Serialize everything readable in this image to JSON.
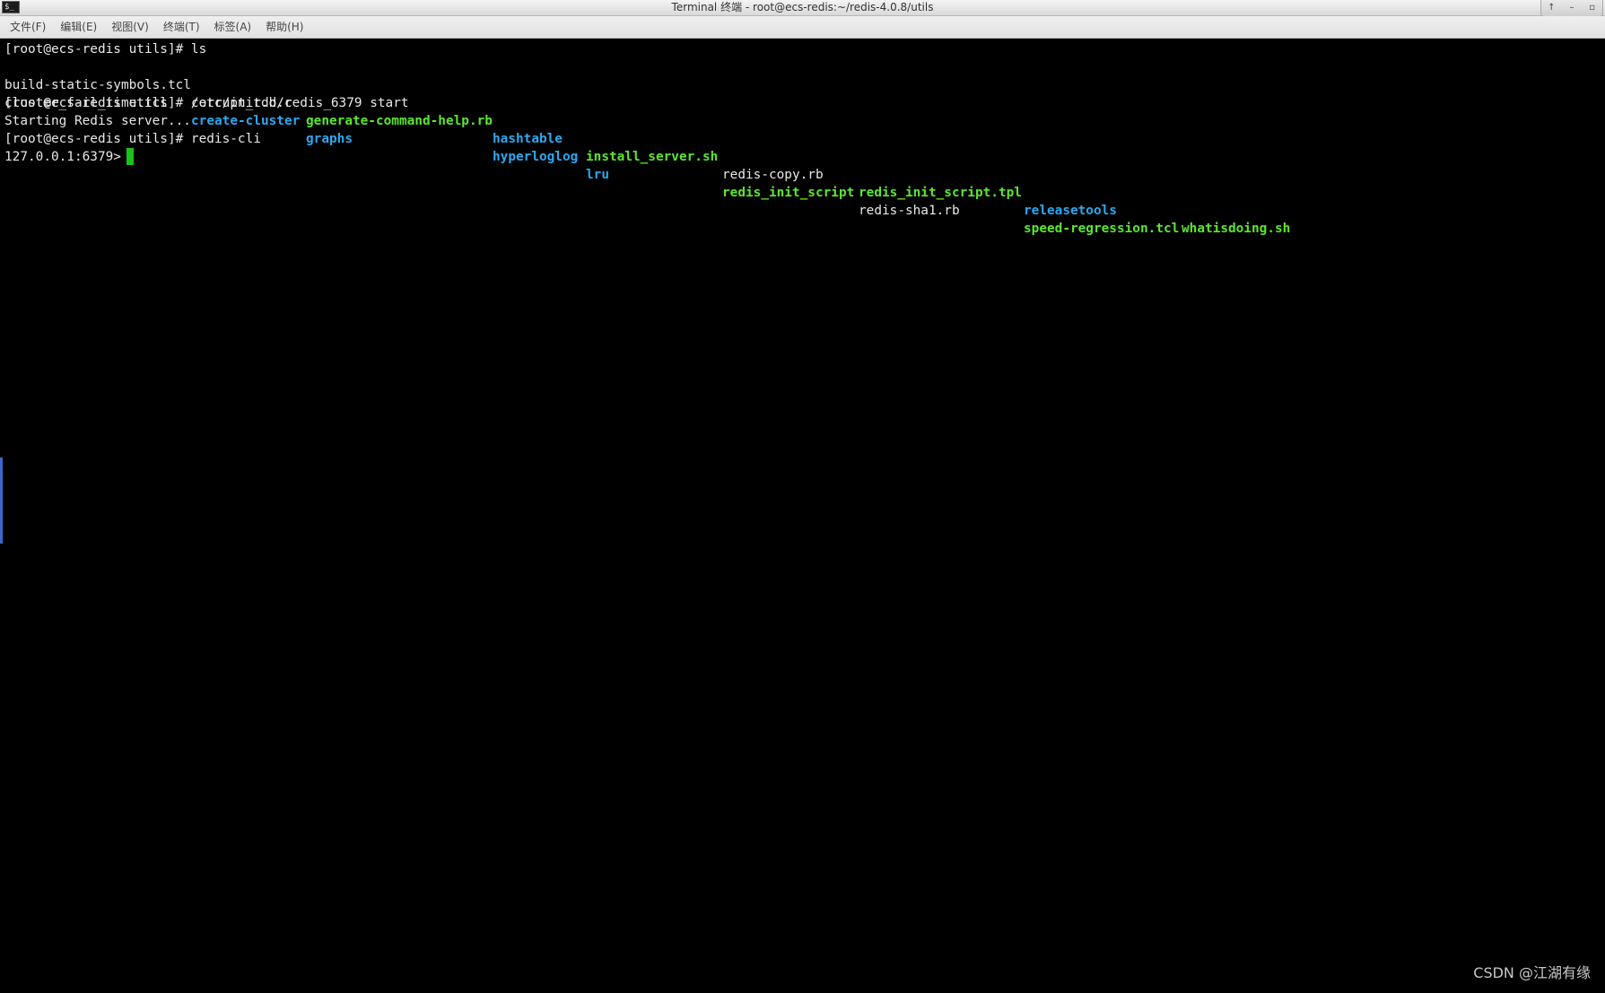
{
  "window": {
    "title": "Terminal 终端 - root@ecs-redis:~/redis-4.0.8/utils",
    "app_icon_glyph": "$_",
    "controls": [
      "↑",
      "–",
      "▫"
    ]
  },
  "menu": [
    "文件(F)",
    "编辑(E)",
    "视图(V)",
    "终端(T)",
    "标签(A)",
    "帮助(H)"
  ],
  "terminal": {
    "colors": {
      "executable": "#5ce62f",
      "directory": "#2da8f0",
      "text": "#e8e8e8",
      "cursor": "#19c319",
      "background": "#000000"
    },
    "line1": "[root@ecs-redis utils]# ls",
    "ls_row1": [
      {
        "name": "build-static-symbols.tcl",
        "type": "plain"
      },
      {
        "name": "corrupt_rdb.c",
        "type": "plain"
      },
      {
        "name": "generate-command-help.rb",
        "type": "exec"
      },
      {
        "name": "hashtable",
        "type": "dir"
      },
      {
        "name": "install_server.sh",
        "type": "exec"
      },
      {
        "name": "redis-copy.rb",
        "type": "plain"
      },
      {
        "name": "redis_init_script.tpl",
        "type": "exec"
      },
      {
        "name": "releasetools",
        "type": "dir"
      },
      {
        "name": "whatisdoing.sh",
        "type": "exec"
      }
    ],
    "ls_row2": [
      {
        "name": "cluster_fail_time.tcl",
        "type": "plain"
      },
      {
        "name": "create-cluster",
        "type": "dir"
      },
      {
        "name": "graphs",
        "type": "dir"
      },
      {
        "name": "hyperloglog",
        "type": "dir"
      },
      {
        "name": "lru",
        "type": "dir"
      },
      {
        "name": "redis_init_script",
        "type": "exec"
      },
      {
        "name": "redis-sha1.rb",
        "type": "plain"
      },
      {
        "name": "speed-regression.tcl",
        "type": "exec"
      }
    ],
    "line4": "[root@ecs-redis utils]# /etc/init.d/redis_6379 start",
    "line5": "Starting Redis server...",
    "line6": "[root@ecs-redis utils]# redis-cli",
    "prompt": "127.0.0.1:6379>"
  },
  "watermark": "CSDN @江湖有缘"
}
